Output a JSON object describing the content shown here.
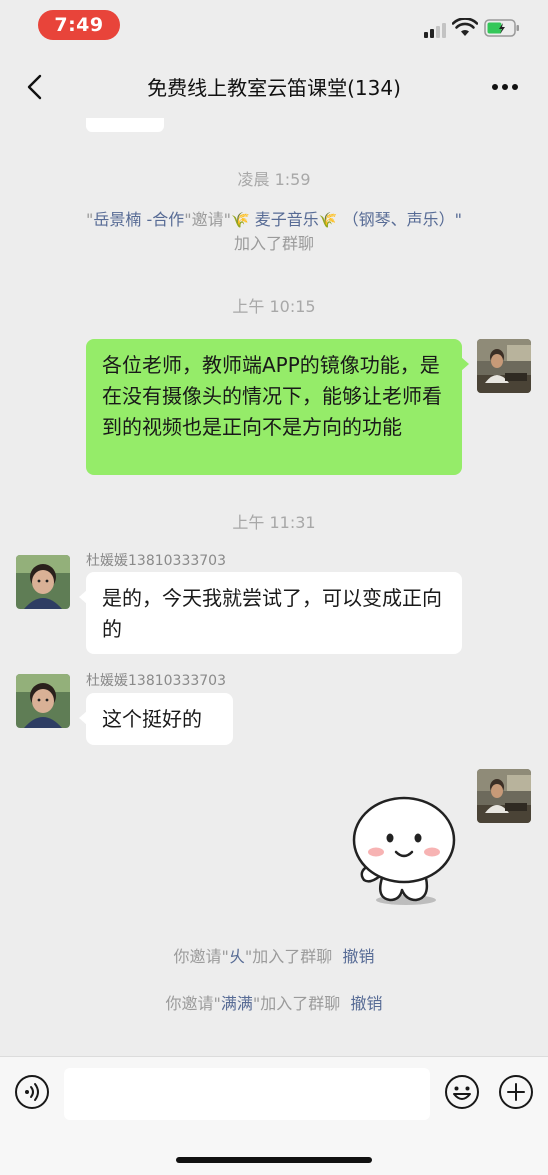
{
  "status_bar": {
    "time": "7:49"
  },
  "nav": {
    "title": "免费线上教室云笛课堂(134)"
  },
  "messages": {
    "time1": "凌晨 1:59",
    "join1": {
      "q1": "\"",
      "inviter": "岳景楠 -合作",
      "q2": "\"邀请\"",
      "wheat1": "🌾",
      "invitee": " 麦子音乐",
      "wheat2": "🌾",
      "invitee_tail": " （钢琴、声乐）\"",
      "suffix": "加入了群聊"
    },
    "time2": "上午 10:15",
    "my_message": "各位老师，教师端APP的镜像功能，是在没有摄像头的情况下，能够让老师看到的视频也是正向不是方向的功能",
    "time3": "上午 11:31",
    "msg2": {
      "sender": "杜媛媛13810333703",
      "text": "是的，今天我就尝试了，可以变成正向的"
    },
    "msg3": {
      "sender": "杜媛媛13810333703",
      "text": "这个挺好的"
    },
    "sys1": {
      "prefix": "你邀请\"",
      "name": "乆",
      "suffix": "\"加入了群聊",
      "action": "撤销"
    },
    "sys2": {
      "prefix": "你邀请\"",
      "name": "满满",
      "suffix": "\"加入了群聊",
      "action": "撤销"
    }
  },
  "input_bar": {
    "placeholder": ""
  },
  "colors": {
    "my_bubble": "#95ec69",
    "other_bubble": "#ffffff",
    "link": "#576b95",
    "time_pill": "#e8443a"
  },
  "icons": {
    "back": "chevron-left-icon",
    "more": "more-dots-icon",
    "voice": "voice-icon",
    "emoji": "emoji-icon",
    "plus": "plus-icon",
    "sticker": "smiling-blob-sticker"
  }
}
